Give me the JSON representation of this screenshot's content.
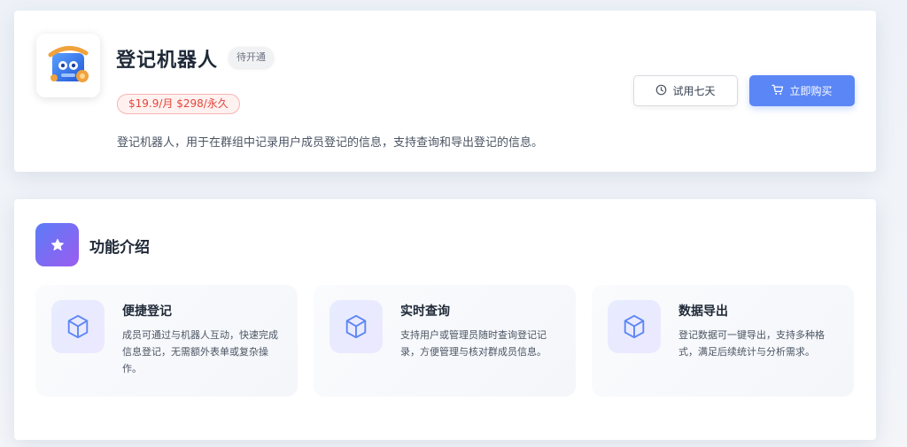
{
  "product": {
    "title": "登记机器人",
    "status": "待开通",
    "price": "$19.9/月 $298/永久",
    "description": "登记机器人，用于在群组中记录用户成员登记的信息，支持查询和导出登记的信息。",
    "logo_icon": "robot-logo-icon"
  },
  "actions": {
    "trial_label": "试用七天",
    "trial_icon": "clock-icon",
    "buy_label": "立即购买",
    "buy_icon": "cart-icon"
  },
  "colors": {
    "accent": "#5b86f5",
    "price": "#e2463b",
    "section_gradient_start": "#5b7cf7",
    "section_gradient_end": "#9b5cf0"
  },
  "features_section": {
    "title": "功能介绍",
    "icon": "star-icon",
    "items": [
      {
        "title": "便捷登记",
        "description": "成员可通过与机器人互动，快速完成信息登记，无需额外表单或复杂操作。",
        "icon": "cube-icon"
      },
      {
        "title": "实时查询",
        "description": "支持用户或管理员随时查询登记记录，方便管理与核对群成员信息。",
        "icon": "cube-icon"
      },
      {
        "title": "数据导出",
        "description": "登记数据可一键导出，支持多种格式，满足后续统计与分析需求。",
        "icon": "cube-icon"
      }
    ]
  }
}
